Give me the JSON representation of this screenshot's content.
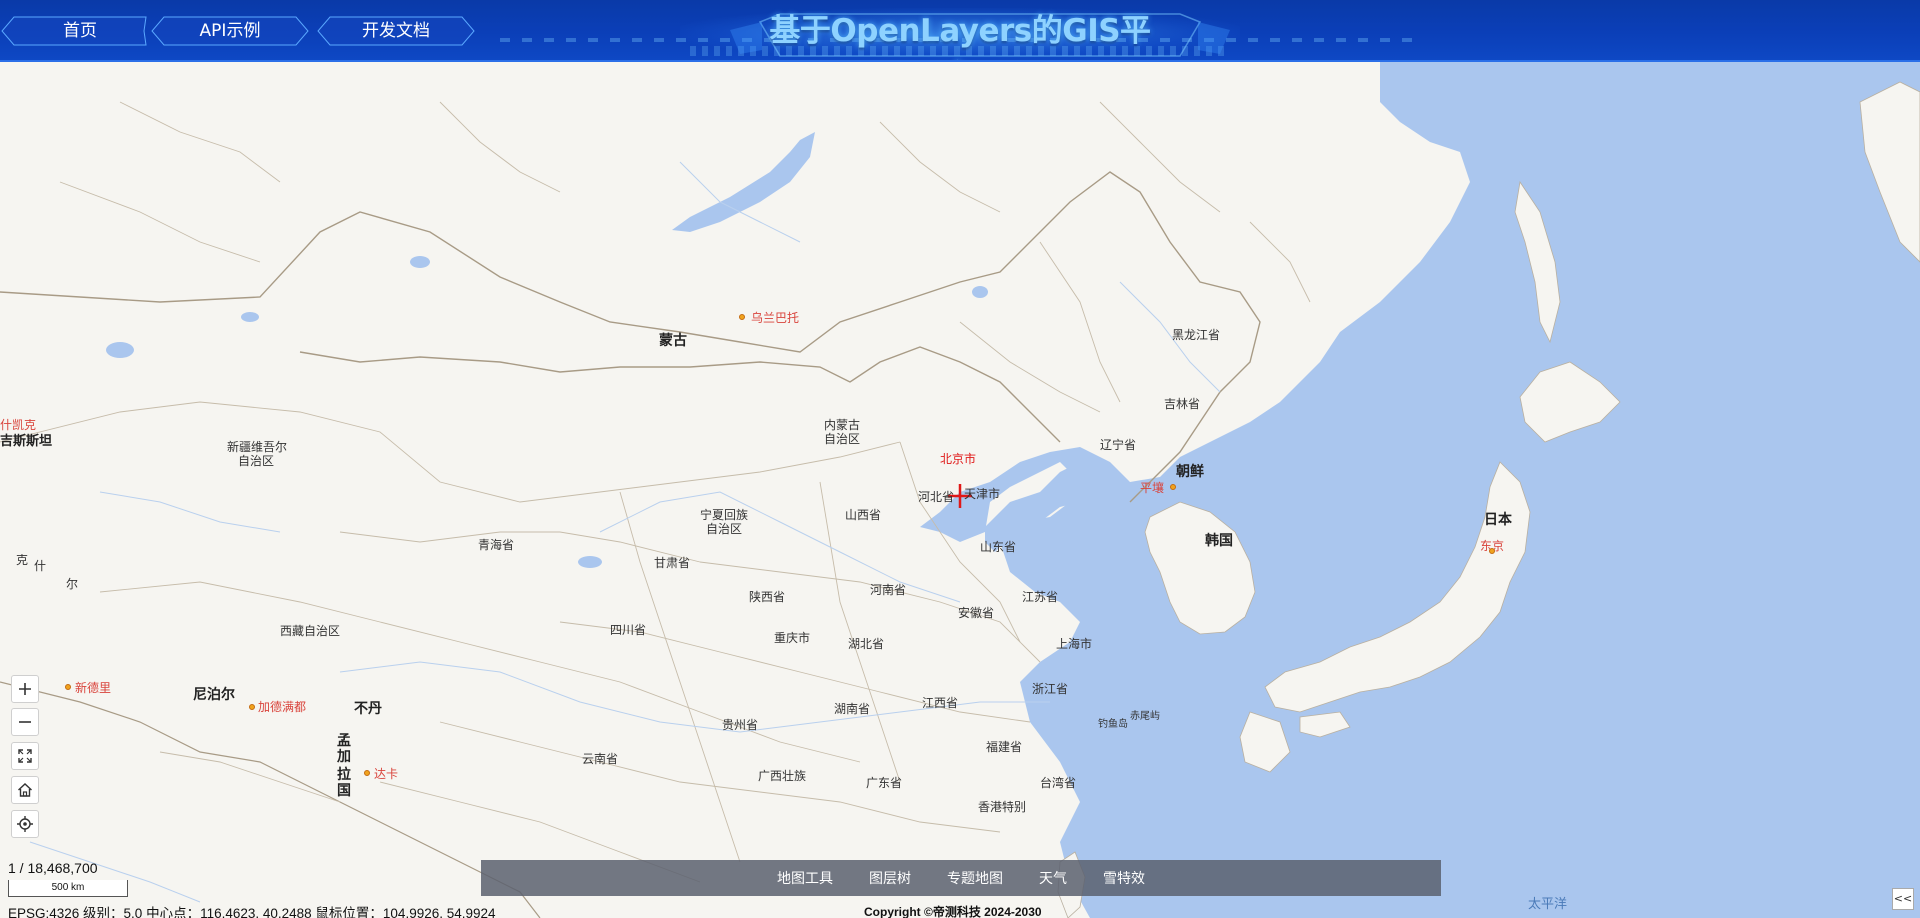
{
  "header": {
    "nav": [
      "首页",
      "API示例",
      "开发文档"
    ],
    "title": "基于OpenLayers的GIS平台"
  },
  "map": {
    "labels": {
      "mongolia": "蒙古",
      "ulaanbaatar": "乌兰巴托",
      "heilongjiang": "黑龙江省",
      "jilin": "吉林省",
      "liaoning": "辽宁省",
      "inner_mongolia_1": "内蒙古",
      "inner_mongolia_2": "自治区",
      "xinjiang_1": "新疆维吾尔",
      "xinjiang_2": "自治区",
      "beijing": "北京市",
      "tianjin": "天津市",
      "hebei": "河北省",
      "shanxi": "山西省",
      "shandong": "山东省",
      "ningxia_1": "宁夏回族",
      "ningxia_2": "自治区",
      "gansu": "甘肃省",
      "qinghai": "青海省",
      "henan": "河南省",
      "shaanxi": "陕西省",
      "jiangsu": "江苏省",
      "anhui": "安徽省",
      "hubei": "湖北省",
      "shanghai": "上海市",
      "sichuan": "四川省",
      "chongqing": "重庆市",
      "xizang": "西藏自治区",
      "zhejiang": "浙江省",
      "hunan": "湖南省",
      "jiangxi": "江西省",
      "guizhou": "贵州省",
      "fujian": "福建省",
      "yunnan": "云南省",
      "guangxi": "广西壮族",
      "guangdong": "广东省",
      "taiwan": "台湾省",
      "hongkong": "香港特别",
      "north_korea": "朝鲜",
      "pyongyang": "平壤",
      "south_korea": "韩国",
      "japan": "日本",
      "tokyo": "东京",
      "nepal": "尼泊尔",
      "kathmandu": "加德满都",
      "bhutan": "不丹",
      "new_delhi": "新德里",
      "bangla_1": "孟",
      "bangla_2": "加",
      "bangla_3": "拉",
      "bangla_4": "国",
      "dhaka": "达卡",
      "pakistan_partial": "吉斯斯坦",
      "tashkent_partial": "什凯克",
      "kashmir_1": "克",
      "kashmir_2": "什",
      "kashmir_3": "尔",
      "diaoyu": "钓鱼岛",
      "chiwei": "赤尾屿",
      "pacific": "太平洋"
    }
  },
  "controls": {
    "scale_ratio": "1 / 18,468,700",
    "scale_bar": "500 km",
    "coordinates": "EPSG:4326 级别：5.0 中心点：116.4623, 40.2488 鼠标位置：104.9926, 54.9924",
    "copyright": "Copyright ©帝测科技 2024-2030",
    "collapse": "<<"
  },
  "toolbar": [
    "地图工具",
    "图层树",
    "专题地图",
    "天气",
    "雪特效"
  ],
  "colors": {
    "header_blue": "#0b3fb8",
    "title_cyan": "#8ed2ff",
    "sea": "#aac6ee",
    "land": "#f6f5f1",
    "city_red": "#d9443c",
    "marker_red": "#e01818"
  }
}
